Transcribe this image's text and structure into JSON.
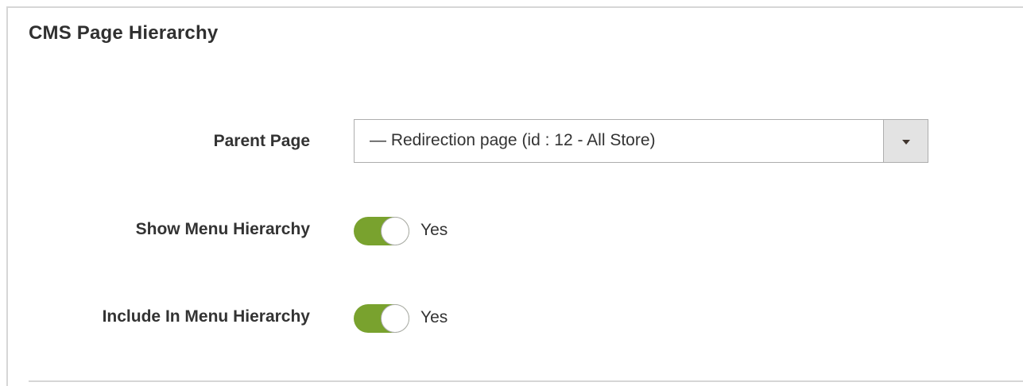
{
  "section": {
    "title": "CMS Page Hierarchy"
  },
  "fields": {
    "parent_page": {
      "label": "Parent Page",
      "selected": "— Redirection page (id : 12 - All Store)"
    },
    "show_menu_hierarchy": {
      "label": "Show Menu Hierarchy",
      "value": "Yes",
      "enabled": true
    },
    "include_in_menu_hierarchy": {
      "label": "Include In Menu Hierarchy",
      "value": "Yes",
      "enabled": true
    }
  },
  "colors": {
    "toggle_on": "#79a22e",
    "border": "#adadad",
    "text": "#333333"
  },
  "icons": {
    "select_arrow": "caret-down-icon"
  }
}
